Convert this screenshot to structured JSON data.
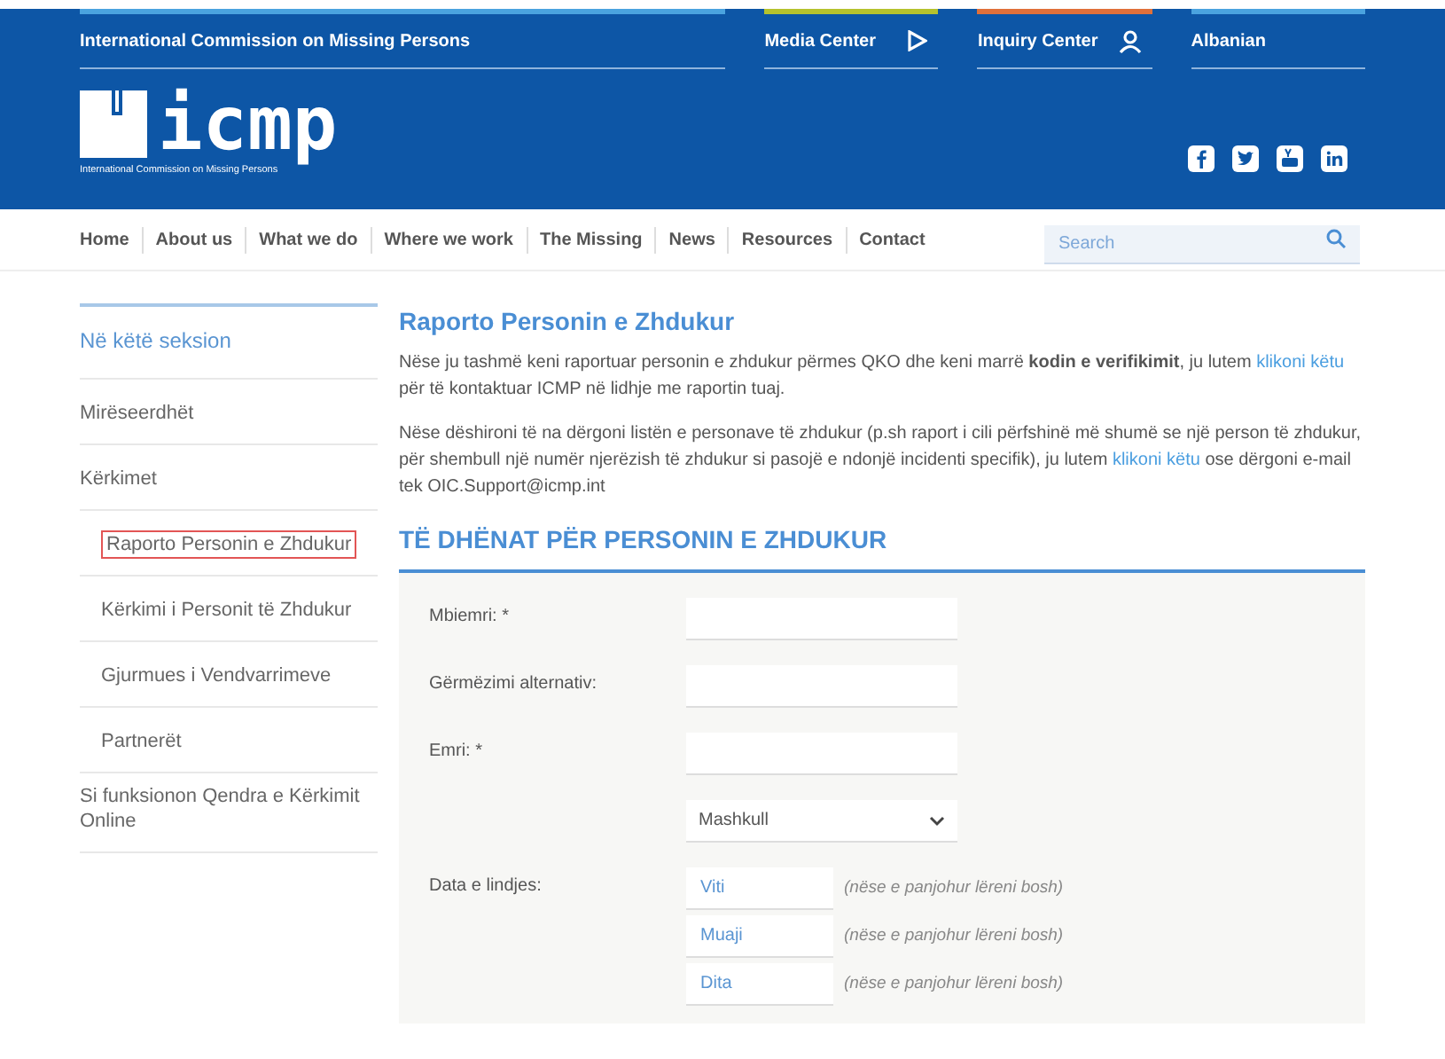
{
  "topbar": {
    "org": "International Commission on Missing Persons",
    "links": [
      {
        "label": "Media Center",
        "kind": "play",
        "color": "#b5c22e"
      },
      {
        "label": "Inquiry Center",
        "kind": "user",
        "color": "#e0703a"
      },
      {
        "label": "Albanian",
        "kind": "none",
        "color": "#4aa3df"
      }
    ]
  },
  "logo": {
    "text": "icmp",
    "tagline": "International Commission on Missing Persons"
  },
  "nav": {
    "items": [
      "Home",
      "About us",
      "What we do",
      "Where we work",
      "The Missing",
      "News",
      "Resources",
      "Contact"
    ],
    "search": {
      "placeholder": "Search"
    }
  },
  "sidebar": {
    "title": "Në këtë seksion",
    "items": [
      {
        "label": "Mirëseerdhët",
        "selected": false
      },
      {
        "label": "Kërkimet",
        "selected": false,
        "children": [
          {
            "label": "Raporto Personin e Zhdukur",
            "selected": true
          },
          {
            "label": "Kërkimi i Personit të Zhdukur",
            "selected": false
          },
          {
            "label": "Gjurmues i Vendvarrimeve",
            "selected": false
          },
          {
            "label": "Partnerët",
            "selected": false
          }
        ]
      },
      {
        "label": "Si funksionon Qendra e Kërkimit Online",
        "selected": false
      }
    ]
  },
  "main": {
    "title": "Raporto Personin e Zhdukur",
    "paragraphs": [
      {
        "text": "Nëse ju tashmë keni raportuar personin e zhdukur përmes QKO dhe keni marrë **kodin e verifikimit**, ju lutem",
        "link": "klikoni këtu",
        "after": "për të kontaktuar ICMP në lidhje me raportin tuaj."
      },
      {
        "text": "Nëse dëshironi të na dërgoni listën e personave të zhdukur (p.sh raport i cili përfshinë më shumë se një person të zhdukur, për shembull një numër njerëzish të zhdukur si pasojë e ndonjë incidenti specifik), ju lutem",
        "link": "klikoni këtu",
        "after": "ose dërgoni e-mail tek OIC.Support@icmp.int"
      }
    ],
    "section_title": "TË DHËNAT PËR PERSONIN E ZHDUKUR",
    "form": [
      {
        "kind": "text",
        "label": "Mbiemri: *"
      },
      {
        "kind": "text",
        "label": "Gërmëzimi alternativ:"
      },
      {
        "kind": "text",
        "label": "Emri: *"
      },
      {
        "kind": "select",
        "value": "Mashkull"
      },
      {
        "kind": "date",
        "label": "Data e lindjes:",
        "parts": [
          {
            "placeholder": "Viti",
            "hint": "(nëse e panjohur lëreni bosh)"
          },
          {
            "placeholder": "Muaji",
            "hint": "(nëse e panjohur lëreni bosh)"
          },
          {
            "placeholder": "Dita",
            "hint": "(nëse e panjohur lëreni bosh)"
          }
        ]
      }
    ]
  }
}
